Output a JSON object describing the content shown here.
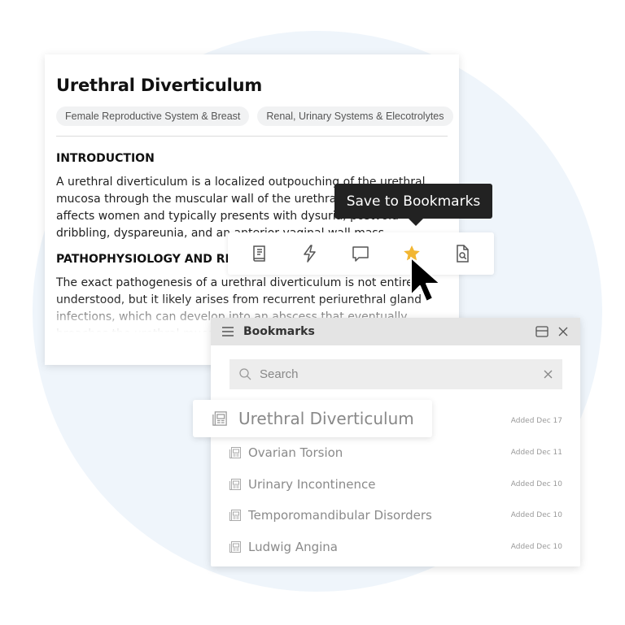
{
  "article": {
    "title": "Urethral Diverticulum",
    "tags": [
      "Female Reproductive System & Breast",
      "Renal, Urinary Systems & Elecotrolytes"
    ],
    "sections": [
      {
        "heading": "INTRODUCTION",
        "body": "A urethral diverticulum is a localized outpouching of the urethral mucosa through the muscular wall of the urethra. It most often affects women and typically presents with dysuria, postvoid dribbling, dyspareunia, and an anterior vaginal wall mass."
      },
      {
        "heading": "PATHOPHYSIOLOGY AND RISK FACTORS",
        "body": "The exact pathogenesis of a urethral diverticulum is not entirely understood, but it likely arises from recurrent periurethral gland infections, which can develop into an abscess that eventually breaches the urethral mucosa. The"
      }
    ]
  },
  "tooltip": {
    "text": "Save to Bookmarks"
  },
  "toolbar": {
    "buttons": [
      {
        "name": "notebook",
        "icon": "book-icon"
      },
      {
        "name": "flashcards",
        "icon": "lightning-icon"
      },
      {
        "name": "comment",
        "icon": "comment-icon"
      },
      {
        "name": "bookmark",
        "icon": "star-icon",
        "active_color": "#f2b632"
      },
      {
        "name": "search-document",
        "icon": "document-search-icon"
      }
    ]
  },
  "bookmarks": {
    "title": "Bookmarks",
    "search": {
      "placeholder": "Search",
      "value": ""
    },
    "dragged_item": "Urethral Diverticulum",
    "items": [
      {
        "title": "Urethral Diverticulum",
        "date": "Added Dec 17"
      },
      {
        "title": "Ovarian Torsion",
        "date": "Added Dec 11"
      },
      {
        "title": "Urinary Incontinence",
        "date": "Added Dec 10"
      },
      {
        "title": "Temporomandibular Disorders",
        "date": "Added Dec 10"
      },
      {
        "title": "Ludwig Angina",
        "date": "Added Dec 10"
      }
    ]
  }
}
